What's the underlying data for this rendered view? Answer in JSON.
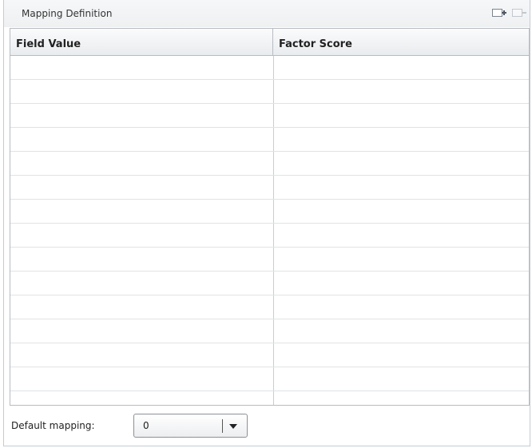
{
  "panel": {
    "title": "Mapping Definition",
    "icons": {
      "add": "add-row-icon",
      "remove": "remove-row-icon"
    }
  },
  "table": {
    "columns": [
      "Field Value",
      "Factor Score"
    ],
    "rows": [
      [
        "",
        ""
      ],
      [
        "",
        ""
      ],
      [
        "",
        ""
      ],
      [
        "",
        ""
      ],
      [
        "",
        ""
      ],
      [
        "",
        ""
      ],
      [
        "",
        ""
      ],
      [
        "",
        ""
      ],
      [
        "",
        ""
      ],
      [
        "",
        ""
      ],
      [
        "",
        ""
      ],
      [
        "",
        ""
      ],
      [
        "",
        ""
      ],
      [
        "",
        ""
      ],
      [
        "",
        ""
      ]
    ]
  },
  "footer": {
    "default_mapping_label": "Default mapping:",
    "default_mapping_value": "0",
    "dropdown_icon": "chevron-down-icon"
  },
  "colors": {
    "border": "#b7bcc2",
    "row_line": "#dfe3e7",
    "header_bg": "#eef0f2"
  }
}
